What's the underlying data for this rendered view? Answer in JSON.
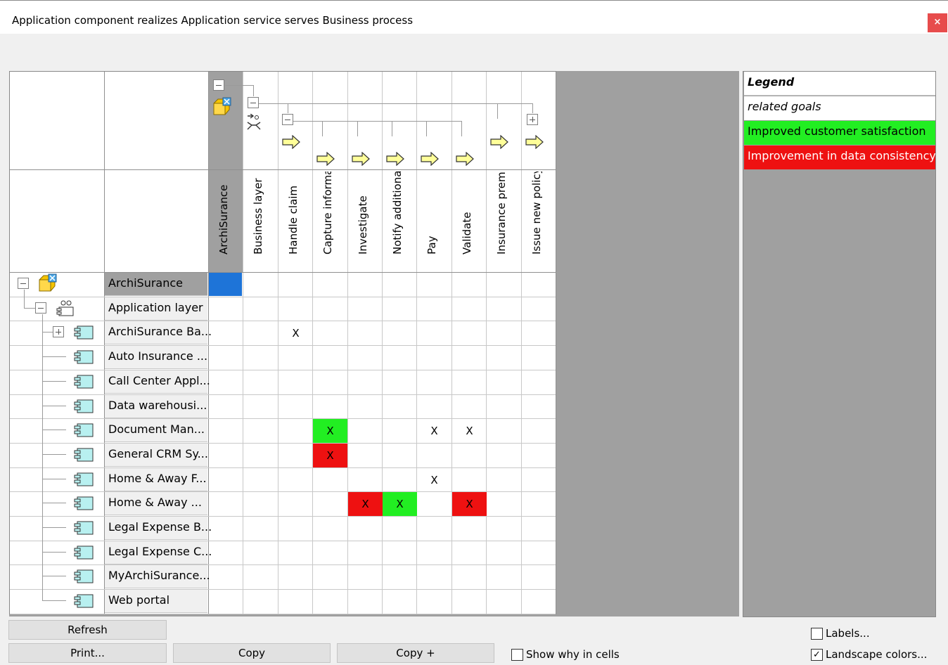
{
  "window": {
    "title": "Application component realizes Application service serves Business process",
    "close_label": "×"
  },
  "columns": [
    {
      "label": "ArchiSurance",
      "icon": "archisurance-box-icon"
    },
    {
      "label": "Business layer",
      "icon": "business-process-icon"
    },
    {
      "label": "Handle claim",
      "icon": "process-arrow-icon"
    },
    {
      "label": "Capture informa",
      "icon": "process-arrow-icon"
    },
    {
      "label": "Investigate",
      "icon": "process-arrow-icon"
    },
    {
      "label": "Notify additiona",
      "icon": "process-arrow-icon"
    },
    {
      "label": "Pay",
      "icon": "process-arrow-icon"
    },
    {
      "label": "Validate",
      "icon": "process-arrow-icon"
    },
    {
      "label": "Insurance premi",
      "icon": "process-arrow-icon"
    },
    {
      "label": "Issue new policy",
      "icon": "process-arrow-icon"
    }
  ],
  "rows": [
    {
      "label": "ArchiSurance",
      "icon": "archisurance-box-icon"
    },
    {
      "label": "Application layer",
      "icon": "application-layer-icon"
    },
    {
      "label": "ArchiSurance Ba...",
      "icon": "application-component-icon"
    },
    {
      "label": "Auto Insurance ...",
      "icon": "application-component-icon"
    },
    {
      "label": "Call Center Appl...",
      "icon": "application-component-icon"
    },
    {
      "label": "Data warehousi...",
      "icon": "application-component-icon"
    },
    {
      "label": "Document Man...",
      "icon": "application-component-icon"
    },
    {
      "label": "General CRM Sy...",
      "icon": "application-component-icon"
    },
    {
      "label": "Home & Away F...",
      "icon": "application-component-icon"
    },
    {
      "label": "Home & Away ...",
      "icon": "application-component-icon"
    },
    {
      "label": "Legal Expense B...",
      "icon": "application-component-icon"
    },
    {
      "label": "Legal Expense C...",
      "icon": "application-component-icon"
    },
    {
      "label": "MyArchiSurance...",
      "icon": "application-component-icon"
    },
    {
      "label": "Web  portal",
      "icon": "application-component-icon"
    }
  ],
  "cells": [
    {
      "row": 2,
      "col": 2,
      "mark": "X",
      "color": ""
    },
    {
      "row": 6,
      "col": 3,
      "mark": "X",
      "color": "#22ee22"
    },
    {
      "row": 6,
      "col": 6,
      "mark": "X",
      "color": ""
    },
    {
      "row": 6,
      "col": 7,
      "mark": "X",
      "color": ""
    },
    {
      "row": 7,
      "col": 3,
      "mark": "X",
      "color": "#ee1111"
    },
    {
      "row": 8,
      "col": 6,
      "mark": "X",
      "color": ""
    },
    {
      "row": 9,
      "col": 4,
      "mark": "X",
      "color": "#ee1111"
    },
    {
      "row": 9,
      "col": 5,
      "mark": "X",
      "color": "#22ee22"
    },
    {
      "row": 9,
      "col": 7,
      "mark": "X",
      "color": "#ee1111"
    }
  ],
  "selected_cell": {
    "row": 0,
    "col": 0,
    "color": "#1e74d8"
  },
  "legend": {
    "title": "Legend",
    "subtitle": "related goals",
    "items": [
      {
        "label": "Improved customer satisfaction",
        "color": "#22ee22",
        "text_color": "#000000"
      },
      {
        "label": "Improvement in data consistency",
        "color": "#ee1111",
        "text_color": "#ffffff"
      }
    ]
  },
  "buttons": {
    "refresh": "Refresh",
    "print": "Print...",
    "copy": "Copy",
    "copy_plus": "Copy +"
  },
  "checkboxes": {
    "show_why": {
      "label": "Show why in cells",
      "checked": false
    },
    "labels": {
      "label": "Labels...",
      "checked": false
    },
    "landscape": {
      "label": "Landscape colors...",
      "checked": true,
      "mark": "✓"
    }
  },
  "colors": {
    "accent_blue": "#1e74d8",
    "green": "#22ee22",
    "red": "#ee1111",
    "gray_bg": "#a0a0a0",
    "close_red": "#e74c4c",
    "process_yellow": "#ffff99"
  }
}
